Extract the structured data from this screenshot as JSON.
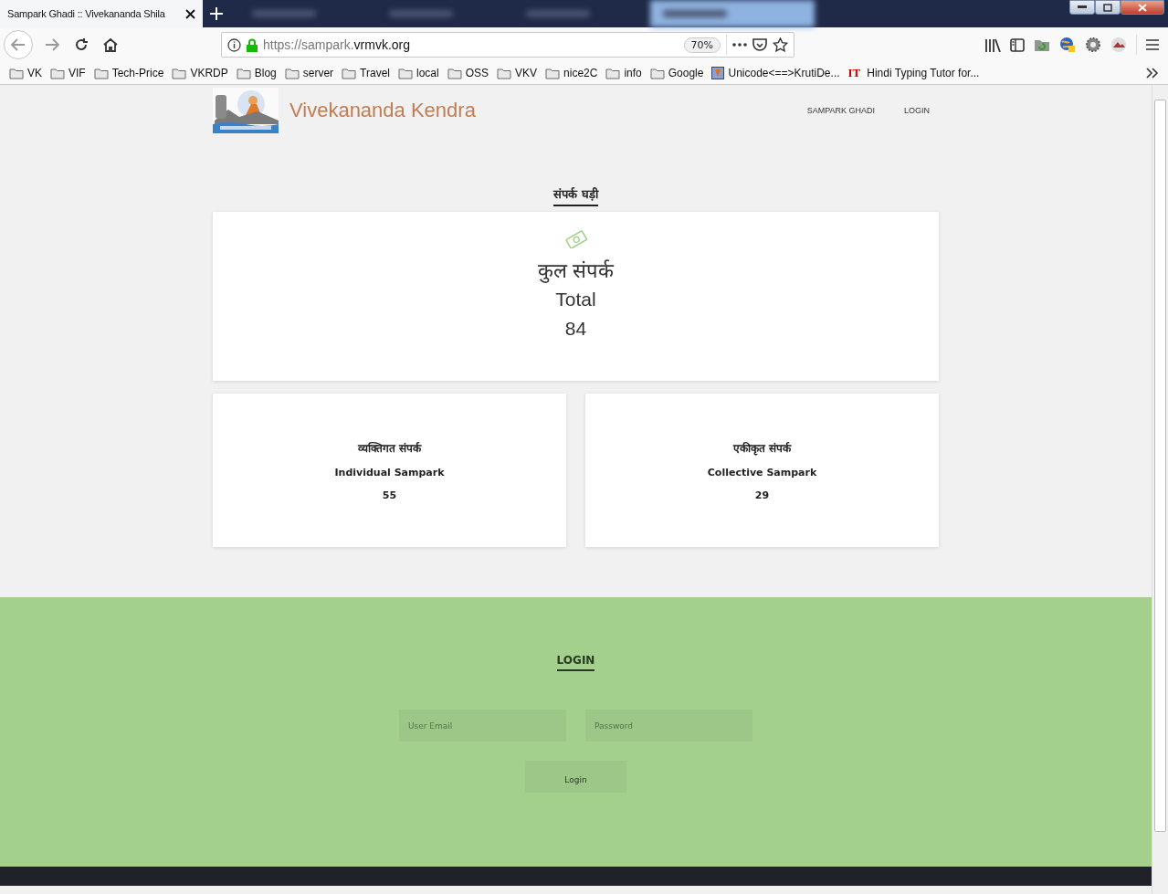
{
  "browser": {
    "active_tab": {
      "title": "Sampark Ghadi :: Vivekananda Shila"
    },
    "other_tabs": [
      {
        "highlighted": false
      },
      {
        "highlighted": false
      },
      {
        "highlighted": false
      },
      {
        "highlighted": true
      }
    ],
    "address": {
      "scheme": "https://sampark.",
      "domain": "vrmvk.org"
    },
    "zoom": "70%",
    "bookmarks": [
      {
        "label": "VK",
        "kind": "folder"
      },
      {
        "label": "VIF",
        "kind": "folder"
      },
      {
        "label": "Tech-Price",
        "kind": "folder"
      },
      {
        "label": "VKRDP",
        "kind": "folder"
      },
      {
        "label": "Blog",
        "kind": "folder"
      },
      {
        "label": "server",
        "kind": "folder"
      },
      {
        "label": "Travel",
        "kind": "folder"
      },
      {
        "label": "local",
        "kind": "folder"
      },
      {
        "label": "OSS",
        "kind": "folder"
      },
      {
        "label": "VKV",
        "kind": "folder"
      },
      {
        "label": "nice2C",
        "kind": "folder"
      },
      {
        "label": "info",
        "kind": "folder"
      },
      {
        "label": "Google",
        "kind": "folder"
      },
      {
        "label": "Unicode<==>KrutiDe...",
        "kind": "page"
      },
      {
        "label": "Hindi Typing Tutor for...",
        "kind": "badge",
        "badge": "IT"
      }
    ]
  },
  "site": {
    "brand": "Vivekananda Kendra",
    "nav": [
      {
        "label": "SAMPARK GHADI"
      },
      {
        "label": "LOGIN"
      }
    ]
  },
  "section_title": "संपर्क घड़ी",
  "total": {
    "label_hi": "कुल संपर्क",
    "label_en": "Total",
    "value": "84"
  },
  "cards": [
    {
      "label_hi": "व्यक्तिगत संपर्क",
      "label_en": "Individual Sampark",
      "value": "55"
    },
    {
      "label_hi": "एकीकृत संपर्क",
      "label_en": "Collective Sampark",
      "value": "29"
    }
  ],
  "login": {
    "title": "LOGIN",
    "email_placeholder": "User Email",
    "password_placeholder": "Password",
    "button": "Login"
  }
}
